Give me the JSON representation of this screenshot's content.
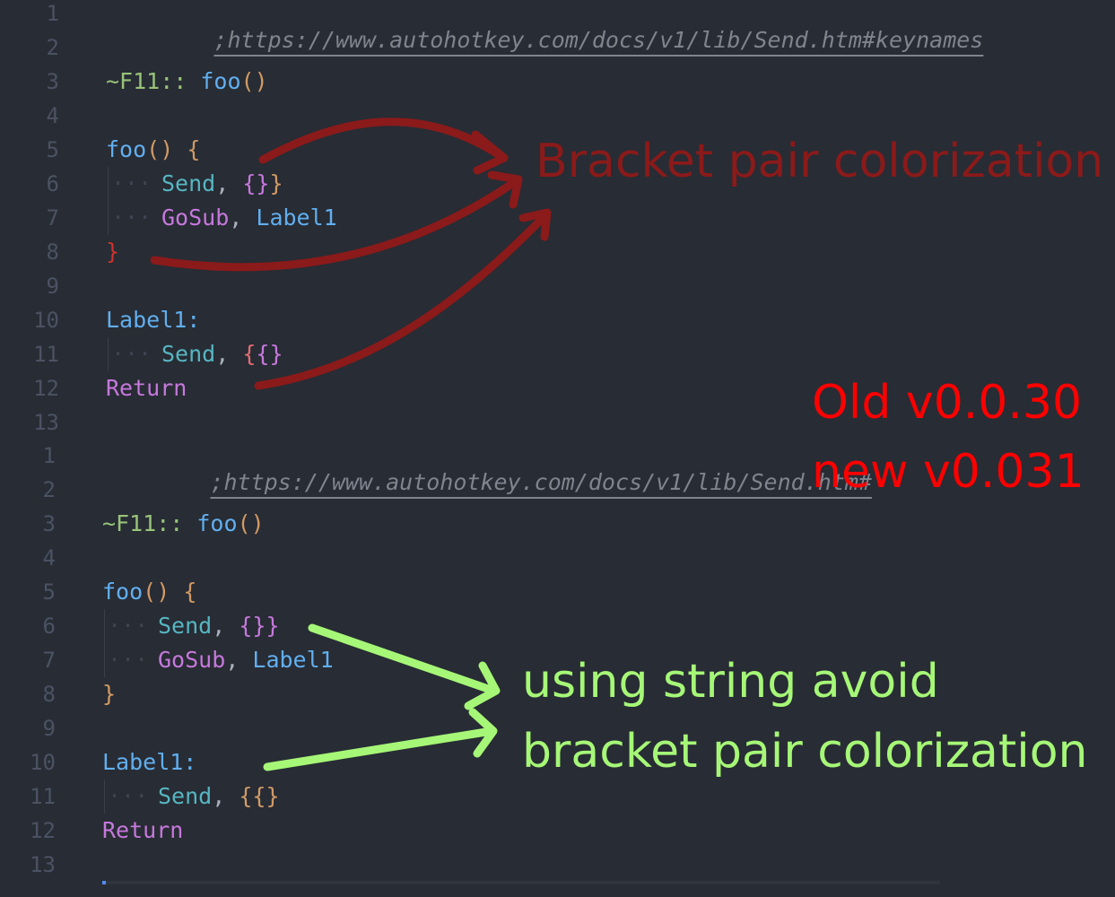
{
  "annotations": {
    "red_label": "Bracket pair colorization",
    "version_old": "Old v0.0.30",
    "version_new": "new v0.031",
    "green_line1": "using string avoid",
    "green_line2": "bracket pair colorization"
  },
  "colors": {
    "background": "#282c34",
    "dark_red_arrow": "#8b1a1a",
    "red_text": "#ff0000",
    "green_arrow": "#a6f777"
  },
  "old_editor": {
    "line_numbers": [
      "1",
      "2",
      "3",
      "4",
      "5",
      "6",
      "7",
      "8",
      "9",
      "10",
      "11",
      "12",
      "13"
    ],
    "l1_comment": ";https://www.autohotkey.com/docs/v1/lib/Send.htm#keynames",
    "l3_hotkey": "~F11::",
    "l3_call": "foo",
    "l3_paren": "()",
    "l5_fn": "foo",
    "l5_paren": "()",
    "l5_brace": "{",
    "l6_cmd": "Send",
    "l6_comma": ",",
    "l6_b1": "{",
    "l6_b2": "}",
    "l6_b3": "}",
    "l7_cmd": "GoSub",
    "l7_comma": ",",
    "l7_arg": "Label1",
    "l8_brace": "}",
    "l10_label": "Label1:",
    "l11_cmd": "Send",
    "l11_comma": ",",
    "l11_b1": "{",
    "l11_b2": "{",
    "l11_b3": "}",
    "l12_ret": "Return"
  },
  "new_editor": {
    "line_numbers": [
      "1",
      "2",
      "3",
      "4",
      "5",
      "6",
      "7",
      "8",
      "9",
      "10",
      "11",
      "12",
      "13"
    ],
    "l1_comment": ";https://www.autohotkey.com/docs/v1/lib/Send.htm#",
    "l3_hotkey": "~F11::",
    "l3_call": "foo",
    "l3_paren": "()",
    "l5_fn": "foo",
    "l5_paren": "()",
    "l5_brace": "{",
    "l6_cmd": "Send",
    "l6_comma": ",",
    "l6_str": "{}}",
    "l7_cmd": "GoSub",
    "l7_comma": ",",
    "l7_arg": "Label1",
    "l8_brace": "}",
    "l10_label": "Label1:",
    "l11_cmd": "Send",
    "l11_comma": ",",
    "l11_str": "{{}",
    "l12_ret": "Return"
  }
}
